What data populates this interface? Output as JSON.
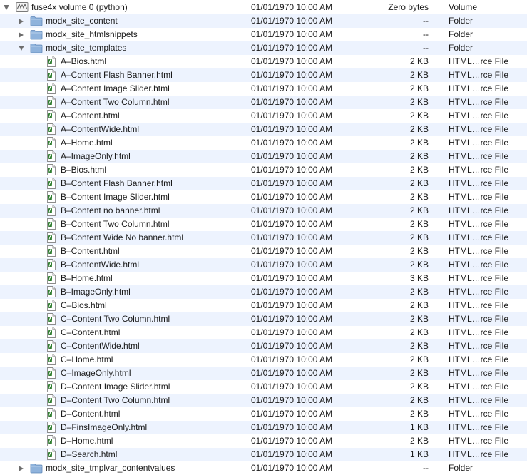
{
  "colors": {
    "row_alt": "#edf3fe",
    "folder": "#8fb3dc",
    "text": "#1a1a1a"
  },
  "rows": [
    {
      "depth": 0,
      "expander": "expanded",
      "icon": "volume-icon",
      "name": "fuse4x volume 0 (python)",
      "date": "01/01/1970 10:00 AM",
      "size": "Zero bytes",
      "kind": "Volume"
    },
    {
      "depth": 1,
      "expander": "collapsed",
      "icon": "folder-icon",
      "name": "modx_site_content",
      "date": "01/01/1970 10:00 AM",
      "size": "--",
      "kind": "Folder"
    },
    {
      "depth": 1,
      "expander": "collapsed",
      "icon": "folder-icon",
      "name": "modx_site_htmlsnippets",
      "date": "01/01/1970 10:00 AM",
      "size": "--",
      "kind": "Folder"
    },
    {
      "depth": 1,
      "expander": "expanded",
      "icon": "folder-icon",
      "name": "modx_site_templates",
      "date": "01/01/1970 10:00 AM",
      "size": "--",
      "kind": "Folder"
    },
    {
      "depth": 2,
      "expander": "none",
      "icon": "html-file-icon",
      "name": "A–Bios.html",
      "date": "01/01/1970 10:00 AM",
      "size": "2 KB",
      "kind": "HTML…rce File"
    },
    {
      "depth": 2,
      "expander": "none",
      "icon": "html-file-icon",
      "name": "A–Content Flash Banner.html",
      "date": "01/01/1970 10:00 AM",
      "size": "2 KB",
      "kind": "HTML…rce File"
    },
    {
      "depth": 2,
      "expander": "none",
      "icon": "html-file-icon",
      "name": "A–Content Image Slider.html",
      "date": "01/01/1970 10:00 AM",
      "size": "2 KB",
      "kind": "HTML…rce File"
    },
    {
      "depth": 2,
      "expander": "none",
      "icon": "html-file-icon",
      "name": "A–Content Two Column.html",
      "date": "01/01/1970 10:00 AM",
      "size": "2 KB",
      "kind": "HTML…rce File"
    },
    {
      "depth": 2,
      "expander": "none",
      "icon": "html-file-icon",
      "name": "A–Content.html",
      "date": "01/01/1970 10:00 AM",
      "size": "2 KB",
      "kind": "HTML…rce File"
    },
    {
      "depth": 2,
      "expander": "none",
      "icon": "html-file-icon",
      "name": "A–ContentWide.html",
      "date": "01/01/1970 10:00 AM",
      "size": "2 KB",
      "kind": "HTML…rce File"
    },
    {
      "depth": 2,
      "expander": "none",
      "icon": "html-file-icon",
      "name": "A–Home.html",
      "date": "01/01/1970 10:00 AM",
      "size": "2 KB",
      "kind": "HTML…rce File"
    },
    {
      "depth": 2,
      "expander": "none",
      "icon": "html-file-icon",
      "name": "A–ImageOnly.html",
      "date": "01/01/1970 10:00 AM",
      "size": "2 KB",
      "kind": "HTML…rce File"
    },
    {
      "depth": 2,
      "expander": "none",
      "icon": "html-file-icon",
      "name": "B–Bios.html",
      "date": "01/01/1970 10:00 AM",
      "size": "2 KB",
      "kind": "HTML…rce File"
    },
    {
      "depth": 2,
      "expander": "none",
      "icon": "html-file-icon",
      "name": "B–Content Flash Banner.html",
      "date": "01/01/1970 10:00 AM",
      "size": "2 KB",
      "kind": "HTML…rce File"
    },
    {
      "depth": 2,
      "expander": "none",
      "icon": "html-file-icon",
      "name": "B–Content Image Slider.html",
      "date": "01/01/1970 10:00 AM",
      "size": "2 KB",
      "kind": "HTML…rce File"
    },
    {
      "depth": 2,
      "expander": "none",
      "icon": "html-file-icon",
      "name": "B–Content no banner.html",
      "date": "01/01/1970 10:00 AM",
      "size": "2 KB",
      "kind": "HTML…rce File"
    },
    {
      "depth": 2,
      "expander": "none",
      "icon": "html-file-icon",
      "name": "B–Content Two Column.html",
      "date": "01/01/1970 10:00 AM",
      "size": "2 KB",
      "kind": "HTML…rce File"
    },
    {
      "depth": 2,
      "expander": "none",
      "icon": "html-file-icon",
      "name": "B–Content Wide No banner.html",
      "date": "01/01/1970 10:00 AM",
      "size": "2 KB",
      "kind": "HTML…rce File"
    },
    {
      "depth": 2,
      "expander": "none",
      "icon": "html-file-icon",
      "name": "B–Content.html",
      "date": "01/01/1970 10:00 AM",
      "size": "2 KB",
      "kind": "HTML…rce File"
    },
    {
      "depth": 2,
      "expander": "none",
      "icon": "html-file-icon",
      "name": "B–ContentWide.html",
      "date": "01/01/1970 10:00 AM",
      "size": "2 KB",
      "kind": "HTML…rce File"
    },
    {
      "depth": 2,
      "expander": "none",
      "icon": "html-file-icon",
      "name": "B–Home.html",
      "date": "01/01/1970 10:00 AM",
      "size": "3 KB",
      "kind": "HTML…rce File"
    },
    {
      "depth": 2,
      "expander": "none",
      "icon": "html-file-icon",
      "name": "B–ImageOnly.html",
      "date": "01/01/1970 10:00 AM",
      "size": "2 KB",
      "kind": "HTML…rce File"
    },
    {
      "depth": 2,
      "expander": "none",
      "icon": "html-file-icon",
      "name": "C–Bios.html",
      "date": "01/01/1970 10:00 AM",
      "size": "2 KB",
      "kind": "HTML…rce File"
    },
    {
      "depth": 2,
      "expander": "none",
      "icon": "html-file-icon",
      "name": "C–Content Two Column.html",
      "date": "01/01/1970 10:00 AM",
      "size": "2 KB",
      "kind": "HTML…rce File"
    },
    {
      "depth": 2,
      "expander": "none",
      "icon": "html-file-icon",
      "name": "C–Content.html",
      "date": "01/01/1970 10:00 AM",
      "size": "2 KB",
      "kind": "HTML…rce File"
    },
    {
      "depth": 2,
      "expander": "none",
      "icon": "html-file-icon",
      "name": "C–ContentWide.html",
      "date": "01/01/1970 10:00 AM",
      "size": "2 KB",
      "kind": "HTML…rce File"
    },
    {
      "depth": 2,
      "expander": "none",
      "icon": "html-file-icon",
      "name": "C–Home.html",
      "date": "01/01/1970 10:00 AM",
      "size": "2 KB",
      "kind": "HTML…rce File"
    },
    {
      "depth": 2,
      "expander": "none",
      "icon": "html-file-icon",
      "name": "C–ImageOnly.html",
      "date": "01/01/1970 10:00 AM",
      "size": "2 KB",
      "kind": "HTML…rce File"
    },
    {
      "depth": 2,
      "expander": "none",
      "icon": "html-file-icon",
      "name": "D–Content Image Slider.html",
      "date": "01/01/1970 10:00 AM",
      "size": "2 KB",
      "kind": "HTML…rce File"
    },
    {
      "depth": 2,
      "expander": "none",
      "icon": "html-file-icon",
      "name": "D–Content Two Column.html",
      "date": "01/01/1970 10:00 AM",
      "size": "2 KB",
      "kind": "HTML…rce File"
    },
    {
      "depth": 2,
      "expander": "none",
      "icon": "html-file-icon",
      "name": "D–Content.html",
      "date": "01/01/1970 10:00 AM",
      "size": "2 KB",
      "kind": "HTML…rce File"
    },
    {
      "depth": 2,
      "expander": "none",
      "icon": "html-file-icon",
      "name": "D–FinsImageOnly.html",
      "date": "01/01/1970 10:00 AM",
      "size": "1 KB",
      "kind": "HTML…rce File"
    },
    {
      "depth": 2,
      "expander": "none",
      "icon": "html-file-icon",
      "name": "D–Home.html",
      "date": "01/01/1970 10:00 AM",
      "size": "2 KB",
      "kind": "HTML…rce File"
    },
    {
      "depth": 2,
      "expander": "none",
      "icon": "html-file-icon",
      "name": "D–Search.html",
      "date": "01/01/1970 10:00 AM",
      "size": "1 KB",
      "kind": "HTML…rce File"
    },
    {
      "depth": 1,
      "expander": "collapsed",
      "icon": "folder-icon",
      "name": "modx_site_tmplvar_contentvalues",
      "date": "01/01/1970 10:00 AM",
      "size": "--",
      "kind": "Folder"
    }
  ]
}
